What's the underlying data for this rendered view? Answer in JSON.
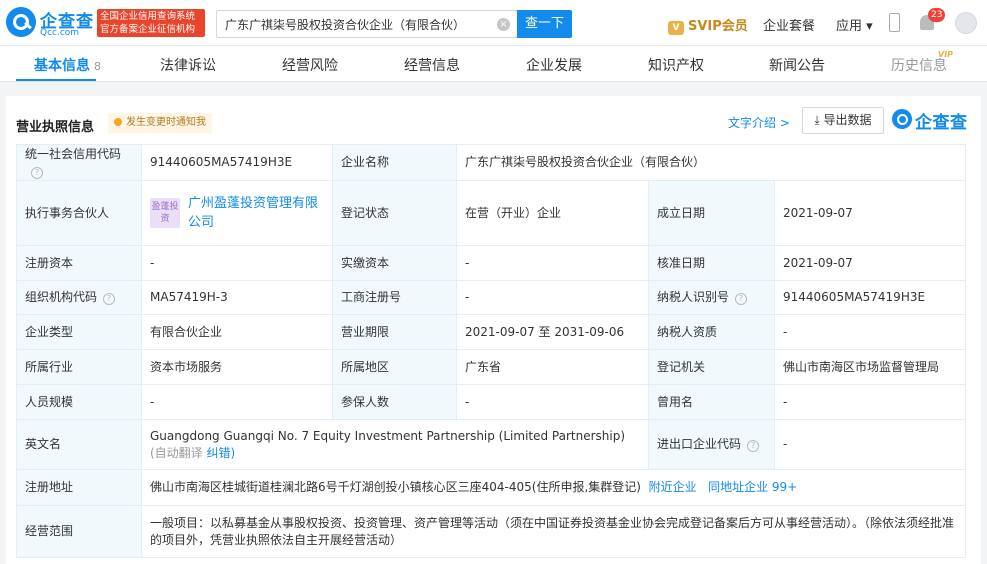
{
  "header": {
    "logo_name": "企查查",
    "logo_domain": "Qcc.com",
    "badge_line1": "全国企业信用查询系统",
    "badge_line2": "官方备案企业征信机构",
    "search_value": "广东广祺柒号股权投资合伙企业（有限合伙）",
    "search_button": "查一下",
    "svip_label": "SVIP会员",
    "suite_label": "企业套餐",
    "apps_label": "应用 ▾",
    "notif_count": "23"
  },
  "tabs": [
    {
      "label": "基本信息",
      "count": "8"
    },
    {
      "label": "法律诉讼"
    },
    {
      "label": "经营风险"
    },
    {
      "label": "经营信息"
    },
    {
      "label": "企业发展"
    },
    {
      "label": "知识产权"
    },
    {
      "label": "新闻公告"
    },
    {
      "label": "历史信息",
      "tag": "VIP"
    }
  ],
  "section": {
    "title": "营业执照信息",
    "tip": "发生变更时通知我",
    "intro_link": "文字介绍 >",
    "export_button": "导出数据",
    "brand": "企查查"
  },
  "info": {
    "credit_code_label": "统一社会信用代码",
    "credit_code": "91440605MA57419H3E",
    "company_name_label": "企业名称",
    "company_name": "广东广祺柒号股权投资合伙企业（有限合伙）",
    "partner_label": "执行事务合伙人",
    "partner_logo": "盈蓬投资",
    "partner": "广州盈蓬投资管理有限公司",
    "status_label": "登记状态",
    "status": "在营（开业）企业",
    "found_date_label": "成立日期",
    "found_date": "2021-09-07",
    "reg_capital_label": "注册资本",
    "reg_capital": "-",
    "paid_capital_label": "实缴资本",
    "paid_capital": "-",
    "approve_date_label": "核准日期",
    "approve_date": "2021-09-07",
    "org_code_label": "组织机构代码",
    "org_code": "MA57419H-3",
    "biz_reg_no_label": "工商注册号",
    "biz_reg_no": "-",
    "taxpayer_id_label": "纳税人识别号",
    "taxpayer_id": "91440605MA57419H3E",
    "type_label": "企业类型",
    "type": "有限合伙企业",
    "term_label": "营业期限",
    "term": "2021-09-07 至 2031-09-06",
    "taxpayer_qual_label": "纳税人资质",
    "taxpayer_qual": "-",
    "industry_label": "所属行业",
    "industry": "资本市场服务",
    "region_label": "所属地区",
    "region": "广东省",
    "authority_label": "登记机关",
    "authority": "佛山市南海区市场监督管理局",
    "staff_label": "人员规模",
    "staff": "-",
    "insured_label": "参保人数",
    "insured": "-",
    "former_name_label": "曾用名",
    "former_name": "-",
    "english_label": "英文名",
    "english": "Guangdong Guangqi No. 7 Equity Investment Partnership (Limited Partnership)",
    "english_note": "(自动翻译",
    "english_fix": "纠错)",
    "import_export_label": "进出口企业代码",
    "import_export": "-",
    "address_label": "注册地址",
    "address": "佛山市南海区桂城街道桂澜北路6号千灯湖创投小镇核心区三座404-405(住所申报,集群登记)",
    "nearby_link": "附近企业",
    "same_addr_link": "同地址企业 99+",
    "scope_label": "经营范围",
    "scope": "一般项目：以私募基金从事股权投资、投资管理、资产管理等活动（须在中国证券投资基金业协会完成登记备案后方可从事经营活动）。（除依法须经批准的项目外，凭营业执照依法自主开展经营活动）"
  }
}
